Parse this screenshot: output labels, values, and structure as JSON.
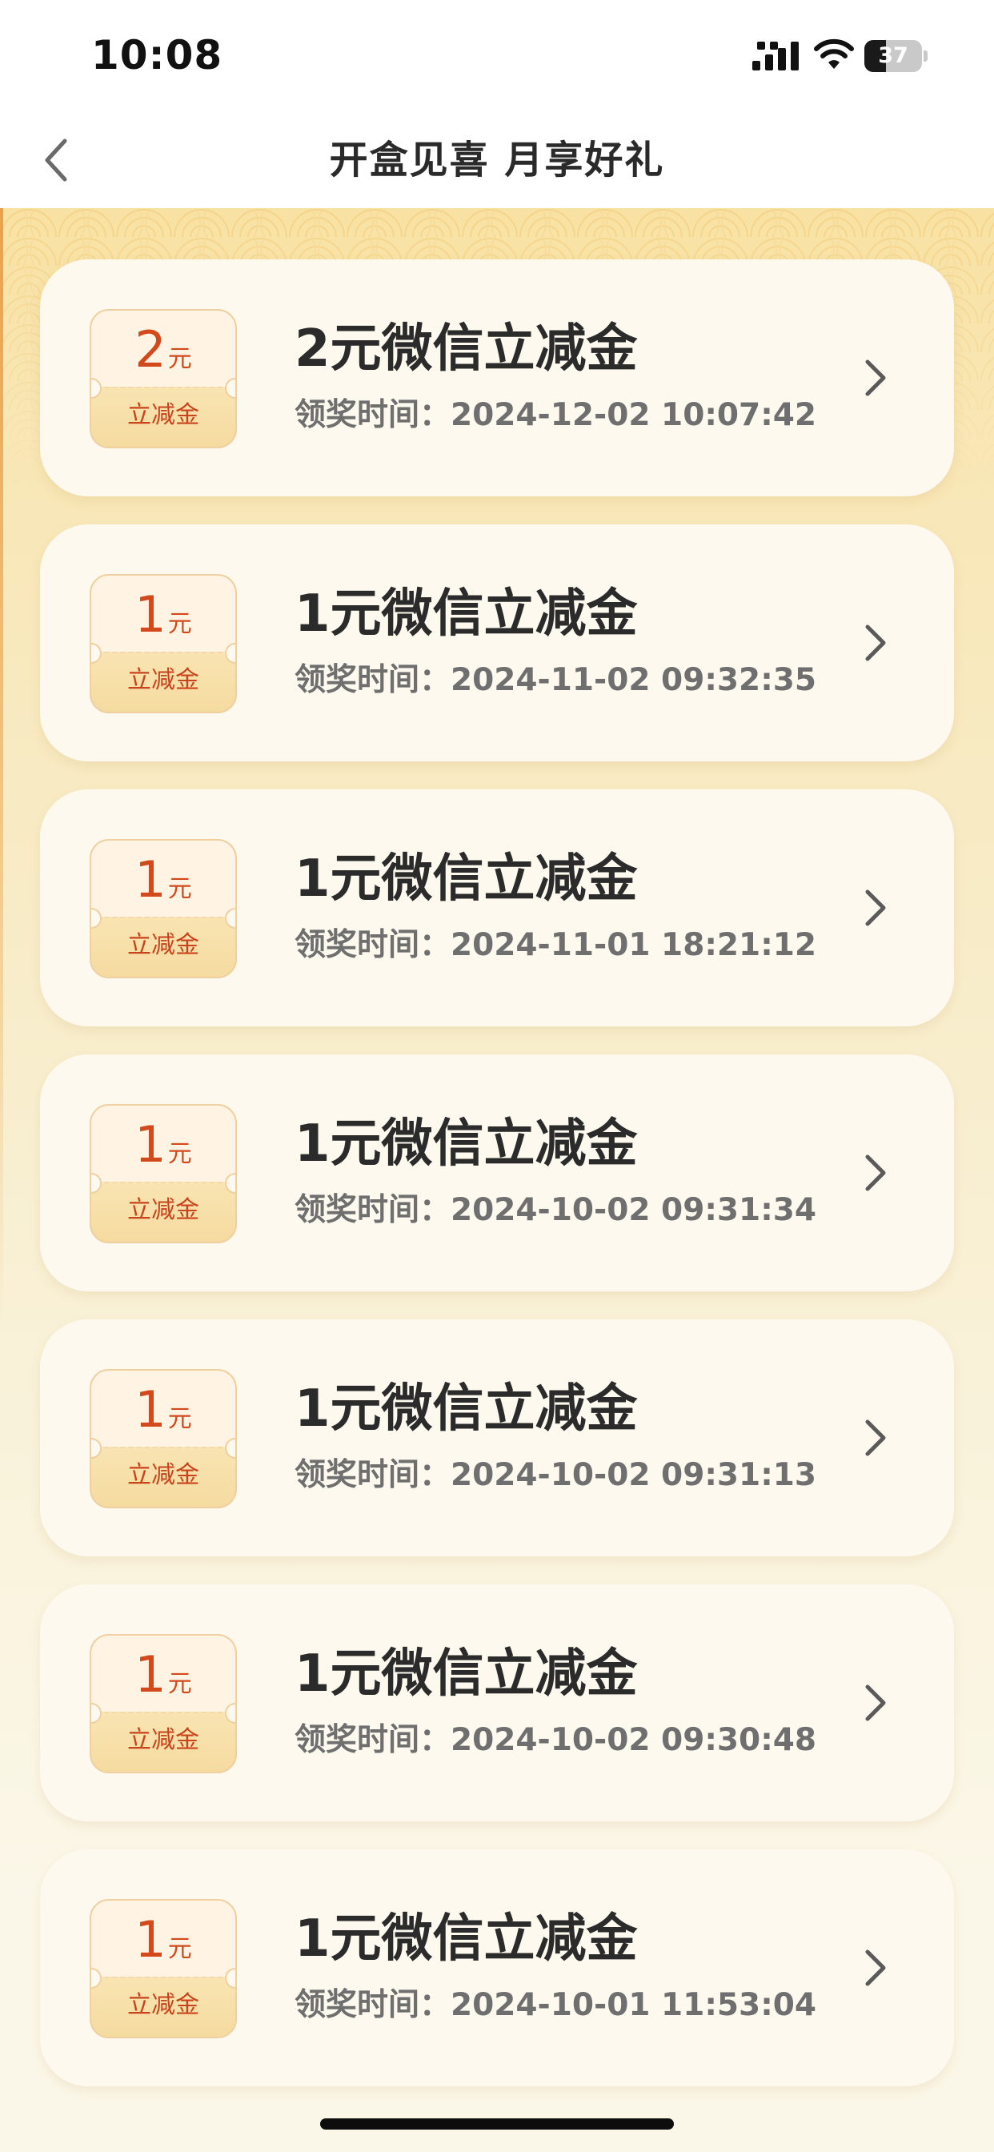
{
  "status_bar": {
    "time": "10:08",
    "battery": "37",
    "battery_level": 0.37
  },
  "nav": {
    "title": "开盒见喜 月享好礼",
    "back_icon": "chevron-left-icon"
  },
  "ticket_label": "立减金",
  "currency_unit": "元",
  "time_prefix": "领奖时间：",
  "rewards": [
    {
      "amount": "2",
      "title": "2元微信立减金",
      "time": "2024-12-02 10:07:42"
    },
    {
      "amount": "1",
      "title": "1元微信立减金",
      "time": "2024-11-02 09:32:35"
    },
    {
      "amount": "1",
      "title": "1元微信立减金",
      "time": "2024-11-01 18:21:12"
    },
    {
      "amount": "1",
      "title": "1元微信立减金",
      "time": "2024-10-02 09:31:34"
    },
    {
      "amount": "1",
      "title": "1元微信立减金",
      "time": "2024-10-02 09:31:13"
    },
    {
      "amount": "1",
      "title": "1元微信立减金",
      "time": "2024-10-02 09:30:48"
    },
    {
      "amount": "1",
      "title": "1元微信立减金",
      "time": "2024-10-01 11:53:04"
    }
  ],
  "colors": {
    "accent": "#d2491b",
    "card_bg": "#fdf9ee",
    "title_text": "#2b2b2b"
  }
}
